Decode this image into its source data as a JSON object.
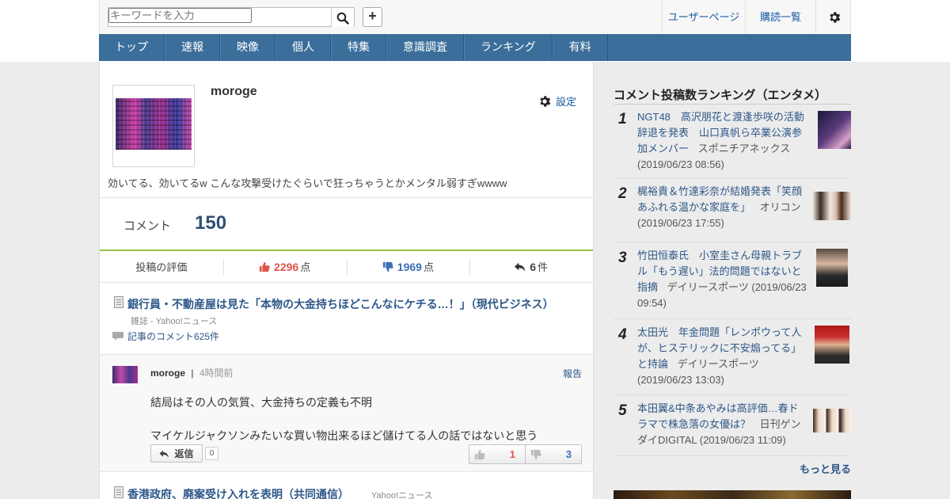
{
  "header": {
    "search_placeholder": "キーワードを入力",
    "plus_label": "+",
    "user_page": "ユーザーページ",
    "subscriptions": "購読一覧"
  },
  "nav": {
    "items": [
      "トップ",
      "速報",
      "映像",
      "個人",
      "特集",
      "意識調査",
      "ランキング",
      "有料"
    ]
  },
  "profile": {
    "username": "moroge",
    "settings": "設定",
    "bio": "効いてる、効いてるw こんな攻撃受けたぐらいで狂っちゃうとかメンタル弱すぎwwww",
    "comment_label": "コメント",
    "comment_count": "150",
    "stats": {
      "rating_label": "投稿の評価",
      "likes": "2296",
      "dislikes": "1969",
      "replies": "6",
      "point_unit": "点",
      "count_unit": "件"
    }
  },
  "article": {
    "title": "銀行員・不動産屋は見た「本物の大金持ちほどこんなにケチる…！」（現代ビジネス）",
    "meta": "雑誌 - Yahoo!ニュース",
    "comments_link": "記事のコメント625件"
  },
  "comment": {
    "user": "moroge",
    "separator": "|",
    "time": "4時間前",
    "report": "報告",
    "line1": "結局はその人の気質、大金持ちの定義も不明",
    "line2": "マイケルジャクソンみたいな買い物出来るほど儲けてる人の話ではないと思う",
    "reply_label": "返信",
    "reply_count": "0",
    "likes": "1",
    "dislikes": "3"
  },
  "next_article": {
    "title": "香港政府、廃案受け入れを表明（共同通信）",
    "source": "Yahoo!ニュース"
  },
  "sidebar": {
    "title": "コメント投稿数ランキング（エンタメ）",
    "items": [
      {
        "rank": "1",
        "title": "NGT48　高沢朋花と渡逢歩咲の活動辞退を発表　山口真帆ら卒業公演参加メンバー",
        "source": "スポニチアネックス",
        "date": "(2019/06/23 08:56)"
      },
      {
        "rank": "2",
        "title": "梶裕貴＆竹達彩奈が結婚発表「笑顔あふれる温かな家庭を」",
        "source": "オリコン",
        "date": "(2019/06/23 17:55)"
      },
      {
        "rank": "3",
        "title": "竹田恒泰氏　小室圭さん母親トラブル「もう遅い」法的問題ではないと指摘",
        "source": "デイリースポーツ",
        "date": "(2019/06/23 09:54)"
      },
      {
        "rank": "4",
        "title": "太田光　年金問題「レンポウって人が、ヒステリックに不安煽ってる」と持論",
        "source": "デイリースポーツ",
        "date": "(2019/06/23 13:03)"
      },
      {
        "rank": "5",
        "title": "本田翼&中条あやみは高評価…春ドラマで株急落の女優は？",
        "source": "日刊ゲンダイDIGITAL",
        "date": "(2019/06/23 11:09)"
      }
    ],
    "more": "もっと見る"
  },
  "colors": {
    "nav_bg": "#3b6e9b",
    "link": "#2d5788",
    "like": "#e0534b",
    "dislike": "#3a70b8",
    "accent_line": "#9cc34a"
  }
}
